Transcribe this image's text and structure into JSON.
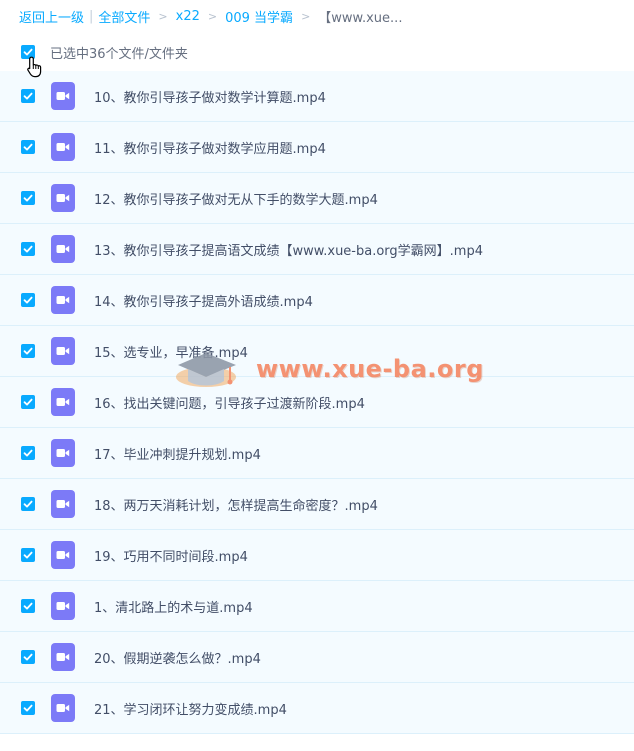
{
  "breadcrumb": {
    "back": "返回上一级",
    "all_files": "全部文件",
    "folder1": "x22",
    "folder2": "009 当学霸",
    "current": "【www.xue..."
  },
  "selection": {
    "label": "已选中36个文件/文件夹"
  },
  "files": [
    {
      "name": "10、教你引导孩子做对数学计算题.mp4",
      "checked": true
    },
    {
      "name": "11、教你引导孩子做对数学应用题.mp4",
      "checked": true
    },
    {
      "name": "12、教你引导孩子做对无从下手的数学大题.mp4",
      "checked": true
    },
    {
      "name": "13、教你引导孩子提高语文成绩【www.xue-ba.org学霸网】.mp4",
      "checked": true
    },
    {
      "name": "14、教你引导孩子提高外语成绩.mp4",
      "checked": true
    },
    {
      "name": "15、选专业，早准备.mp4",
      "checked": true
    },
    {
      "name": "16、找出关键问题，引导孩子过渡新阶段.mp4",
      "checked": true
    },
    {
      "name": "17、毕业冲刺提升规划.mp4",
      "checked": true
    },
    {
      "name": "18、两万天消耗计划，怎样提高生命密度？.mp4",
      "checked": true
    },
    {
      "name": "19、巧用不同时间段.mp4",
      "checked": true
    },
    {
      "name": "1、清北路上的术与道.mp4",
      "checked": true
    },
    {
      "name": "20、假期逆袭怎么做？.mp4",
      "checked": true
    },
    {
      "name": "21、学习闭环让努力变成绩.mp4",
      "checked": true
    }
  ],
  "watermark": {
    "text": "www.xue-ba.org"
  },
  "icons": {
    "checkbox": "checkmark-icon",
    "file": "video-file-icon",
    "cursor": "hand-pointer-icon"
  },
  "colors": {
    "link": "#09aaff",
    "checkbox": "#09aaff",
    "file_icon": "#7c7af7",
    "row_background": "#f4fbff",
    "text": "#424e67",
    "watermark": "#f4845f"
  }
}
